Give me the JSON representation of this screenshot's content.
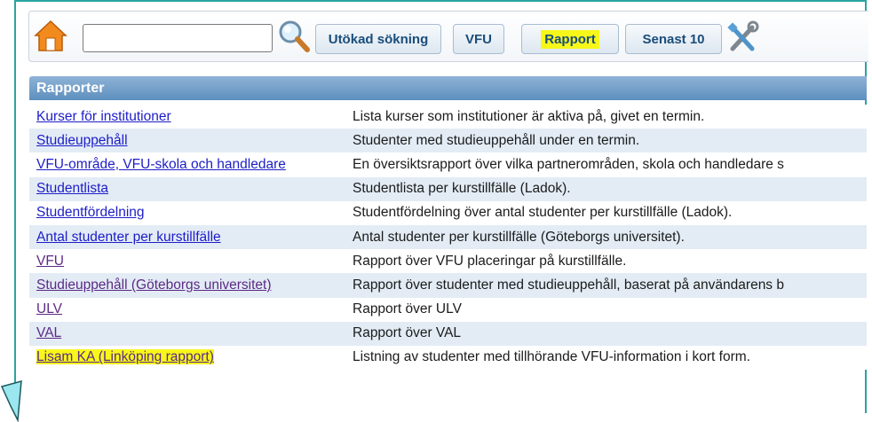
{
  "search": {
    "value": "",
    "placeholder": ""
  },
  "toolbar": {
    "buttons": [
      {
        "label": "Utökad sökning"
      },
      {
        "label": "VFU"
      },
      {
        "label": "Rapport"
      },
      {
        "label": "Senast 10"
      }
    ]
  },
  "section": {
    "title": "Rapporter"
  },
  "reports": [
    {
      "name": "Kurser för institutioner",
      "desc": "Lista kurser som institutioner är aktiva på, givet en termin."
    },
    {
      "name": "Studieuppehåll",
      "desc": "Studenter med studieuppehåll under en termin."
    },
    {
      "name": "VFU-område, VFU-skola och handledare",
      "desc": "En översiktsrapport över vilka partnerområden, skola och handledare s"
    },
    {
      "name": "Studentlista",
      "desc": "Studentlista per kurstillfälle (Ladok)."
    },
    {
      "name": "Studentfördelning",
      "desc": "Studentfördelning över antal studenter per kurstillfälle (Ladok)."
    },
    {
      "name": "Antal studenter per kurstillfälle",
      "desc": "Antal studenter per kurstillfälle (Göteborgs universitet)."
    },
    {
      "name": "VFU",
      "desc": "Rapport över VFU placeringar på kurstillfälle."
    },
    {
      "name": "Studieuppehåll (Göteborgs universitet)",
      "desc": "Rapport över studenter med studieuppehåll, baserat på användarens b"
    },
    {
      "name": "ULV",
      "desc": "Rapport över ULV"
    },
    {
      "name": "VAL",
      "desc": "Rapport över VAL"
    },
    {
      "name": "Lisam KA (Linköping rapport)",
      "desc": "Listning av studenter med tillhörande VFU-information i kort form."
    }
  ],
  "icons": {
    "home": "home-icon",
    "search": "search-icon",
    "tools": "tools-icon",
    "cursor": "cursor-icon"
  },
  "colors": {
    "highlight": "#f7f71a",
    "link": "#1d1dc8",
    "visited_link": "#5b2a86",
    "header": "#6f9bc8",
    "row_alt": "#e3ecf5",
    "frame": "#2aa3a3"
  }
}
